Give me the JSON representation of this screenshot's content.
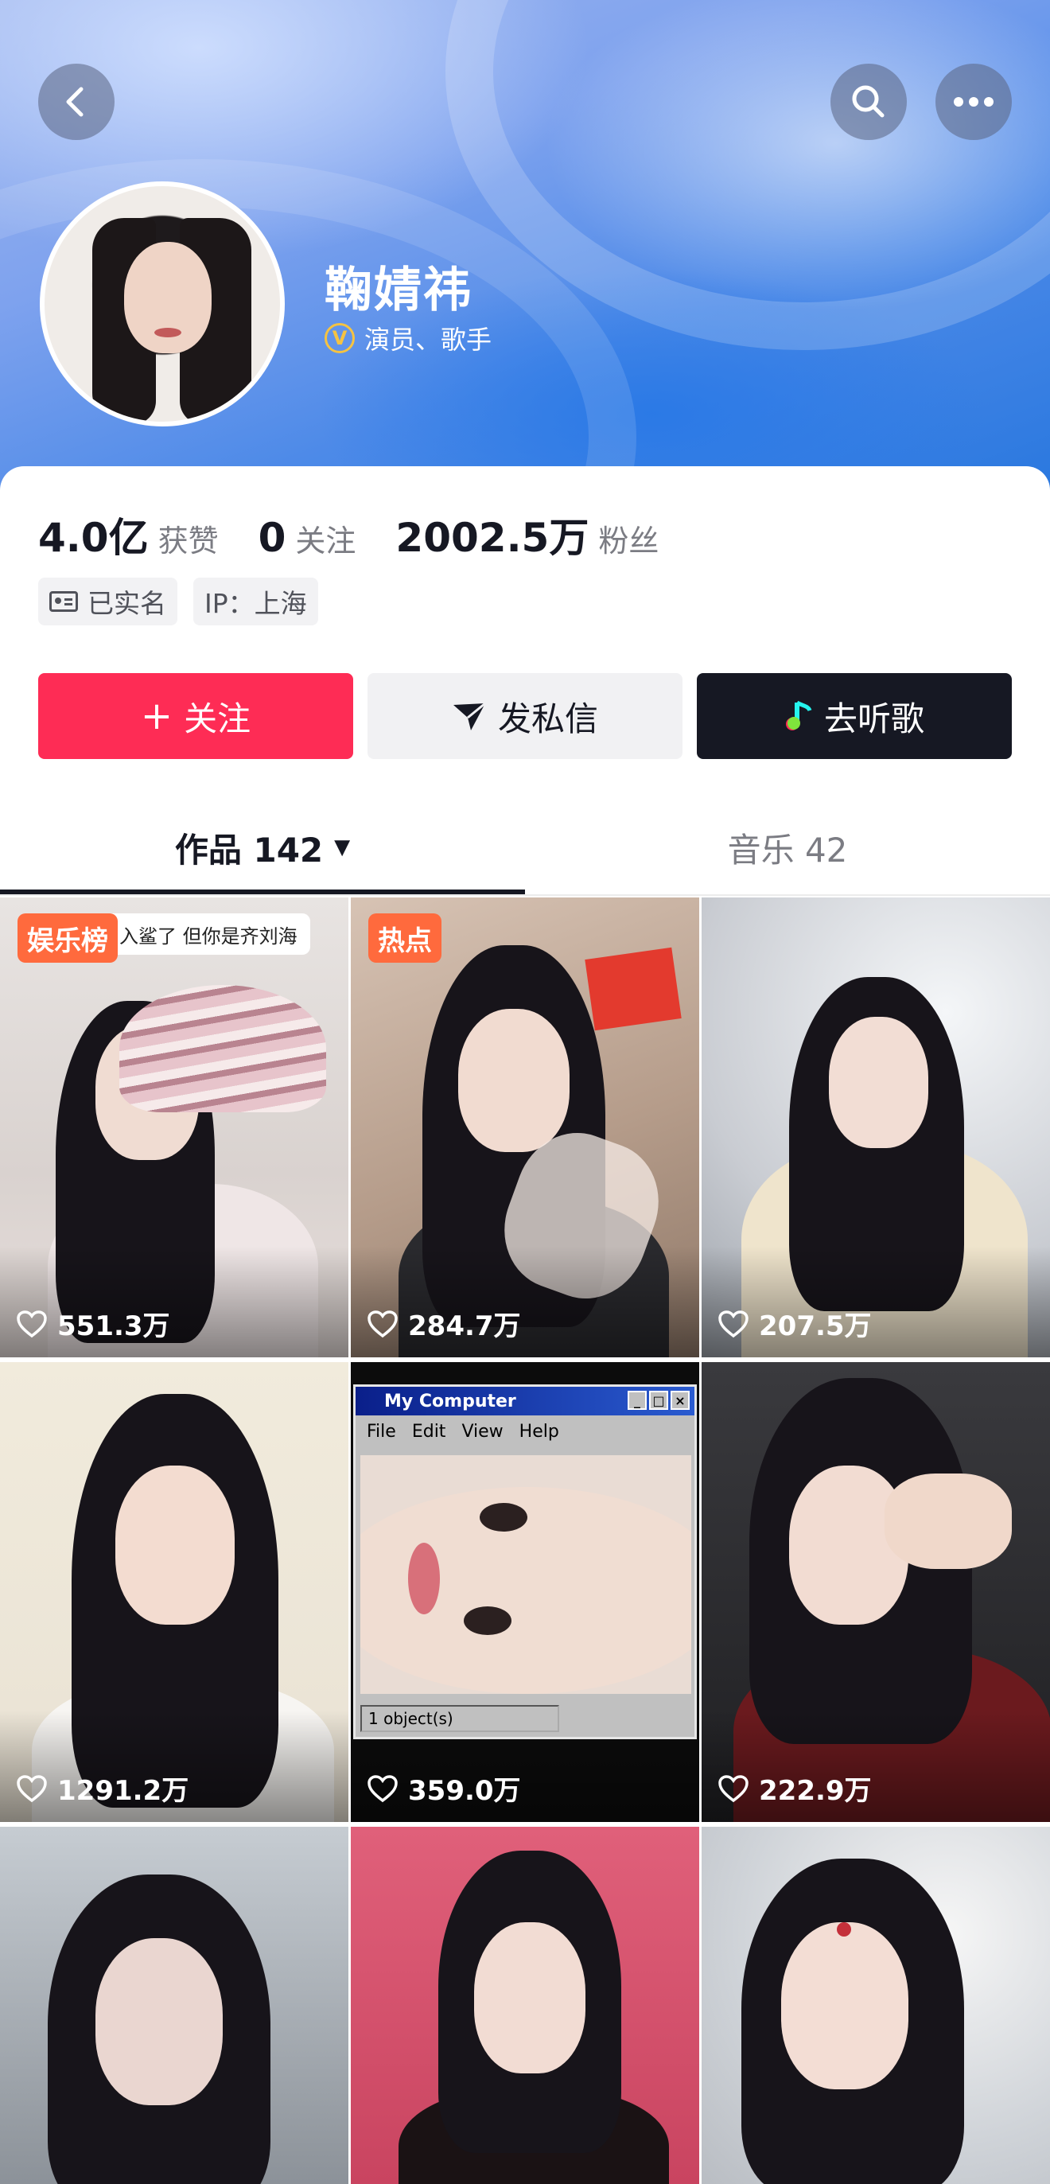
{
  "header": {
    "back_icon": "chevron-left-icon",
    "search_icon": "search-icon",
    "more_icon": "more-horizontal-icon"
  },
  "profile": {
    "name": "鞠婧祎",
    "verified_badge": "V",
    "verified_text": "演员、歌手"
  },
  "stats": [
    {
      "value": "4.0亿",
      "label": "获赞"
    },
    {
      "value": "0",
      "label": "关注"
    },
    {
      "value": "2002.5万",
      "label": "粉丝"
    }
  ],
  "tags": [
    {
      "icon": "id-card-icon",
      "text": "已实名"
    },
    {
      "text": "IP：上海"
    }
  ],
  "actions": {
    "follow": {
      "icon": "+",
      "label": "关注",
      "color": "#fe2c55"
    },
    "message": {
      "icon": "send-icon",
      "label": "发私信"
    },
    "music": {
      "icon": "music-note-icon",
      "label": "去听歌"
    }
  },
  "tabs": {
    "works_label": "作品 142",
    "works_dropdown": "▼",
    "music_label": "音乐 42"
  },
  "grid": [
    {
      "badge": "娱乐榜",
      "badge_color": "#ff6a3d",
      "caption": "入鲨了 但你是齐刘海",
      "likes": "551.3万"
    },
    {
      "badge": "热点",
      "badge_color": "#ff6a3d",
      "likes": "284.7万"
    },
    {
      "likes": "207.5万"
    },
    {
      "likes": "1291.2万"
    },
    {
      "likes": "359.0万",
      "window_title": "My Computer",
      "menu": [
        "File",
        "Edit",
        "View",
        "Help"
      ],
      "status": "1 object(s)"
    },
    {
      "likes": "222.9万"
    },
    {},
    {},
    {}
  ]
}
